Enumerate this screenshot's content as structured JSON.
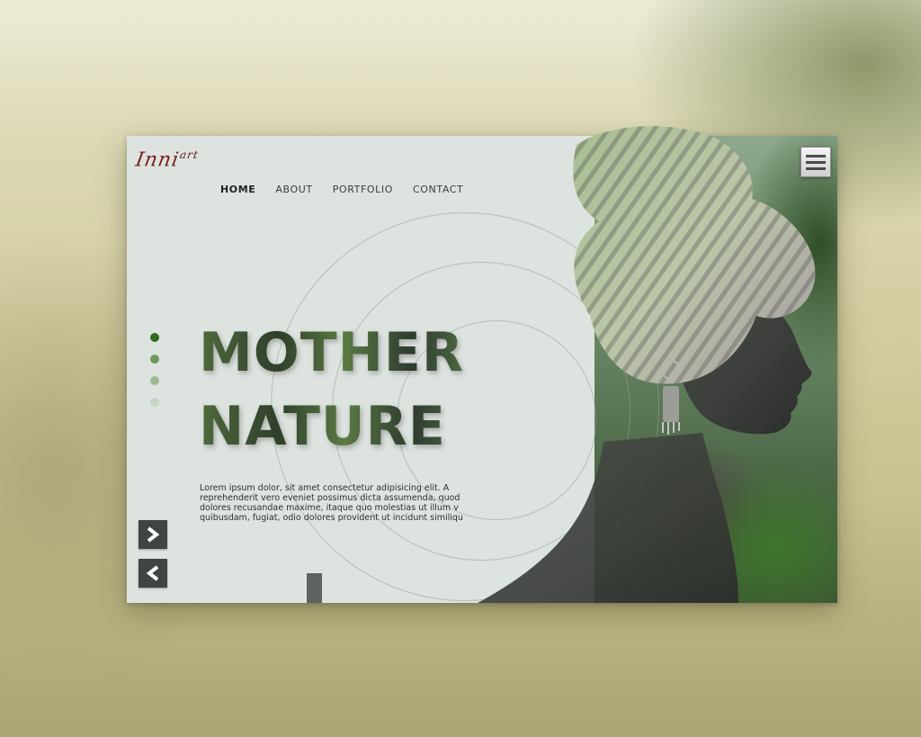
{
  "logo": {
    "text": "Inni",
    "superscript": "art"
  },
  "nav": {
    "items": [
      {
        "label": "HOME",
        "active": true
      },
      {
        "label": "ABOUT",
        "active": false
      },
      {
        "label": "PORTFOLIO",
        "active": false
      },
      {
        "label": "CONTACT",
        "active": false
      }
    ]
  },
  "menu": {
    "icon": "hamburger-menu-icon"
  },
  "hero": {
    "title_line1": "MOTHER",
    "title_line2": "NATURE",
    "body": "Lorem ipsum dolor, sit amet consectetur adipisicing elit. A reprehenderit vero eveniet possimus dicta assumenda, quod dolores recusandae maxime, itaque quo molestias ut illum v quibusdam, fugiat, odio dolores provident ut incidunt similiqu"
  },
  "pagination": {
    "dot_colors": [
      "#2f6b1f",
      "#6d9a5c",
      "#9dbb92",
      "#c7d5c4"
    ],
    "active_index": 0,
    "count": 4
  },
  "controls": {
    "next_icon": "chevron-right-icon",
    "prev_icon": "chevron-left-icon"
  },
  "colors": {
    "card_bg": "#dde3df",
    "accent": "#3f5a34",
    "button_bg": "#3f4542"
  }
}
